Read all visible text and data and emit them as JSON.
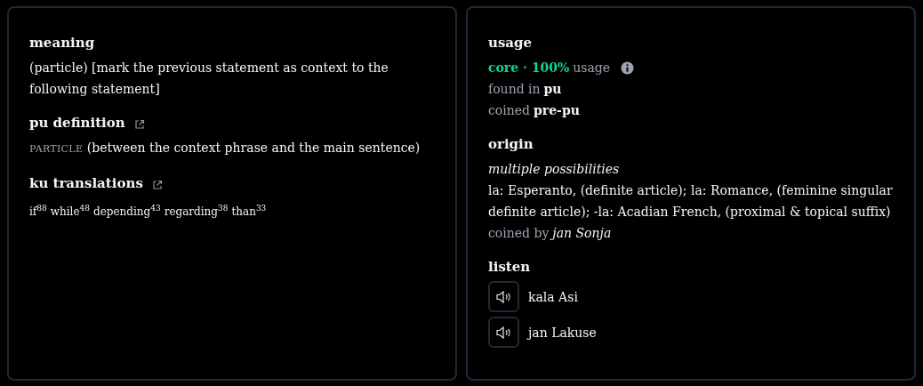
{
  "meaning": {
    "heading": "meaning",
    "link": false,
    "text": "(particle) [mark the previous statement as context to the following statement]"
  },
  "pu_definition": {
    "heading": "pu definition",
    "link": true,
    "part_of_speech": "PARTICLE",
    "text": "(between the context phrase and the main sentence)"
  },
  "ku_translations": {
    "heading": "ku translations",
    "link": true,
    "words": [
      {
        "word": "if",
        "count": "88"
      },
      {
        "word": "while",
        "count": "48"
      },
      {
        "word": "depending",
        "count": "43"
      },
      {
        "word": "regarding",
        "count": "38"
      },
      {
        "word": "than",
        "count": "33"
      }
    ]
  },
  "usage": {
    "heading": "usage",
    "category": "core · 100%",
    "label": "usage",
    "found_in_label": "found in",
    "found_in": "pu",
    "coined_label": "coined",
    "coined": "pre-pu"
  },
  "origin": {
    "heading": "origin",
    "note": "multiple possibilities",
    "text": "la: Esperanto, (definite article); la: Romance, (feminine singular definite article); -la: Acadian French, (proximal & topical suffix)",
    "coined_by_label": "coined by",
    "coined_by": "jan Sonja"
  },
  "listen": {
    "heading": "listen",
    "clips": [
      {
        "name": "kala Asi"
      },
      {
        "name": "jan Lakuse"
      }
    ]
  }
}
